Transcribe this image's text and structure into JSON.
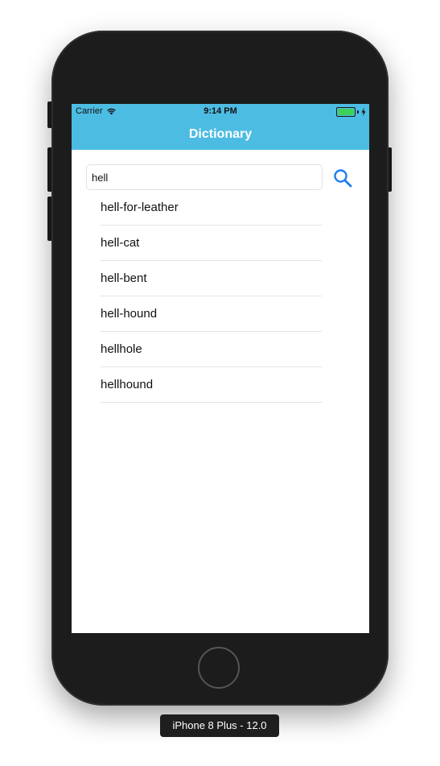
{
  "status_bar": {
    "carrier": "Carrier",
    "time": "9:14 PM",
    "battery_level": 1.0,
    "charging": true,
    "battery_color": "#3dd15a"
  },
  "nav": {
    "title": "Dictionary",
    "background_color": "#4dbce3"
  },
  "search": {
    "value": "hell",
    "placeholder": "",
    "button_icon": "search-icon",
    "icon_color": "#1a7cf0"
  },
  "results": {
    "items": [
      "hell-for-leather",
      "hell-cat",
      "hell-bent",
      "hell-hound",
      "hellhole",
      "hellhound"
    ]
  },
  "device": {
    "label": "iPhone 8 Plus - 12.0"
  }
}
